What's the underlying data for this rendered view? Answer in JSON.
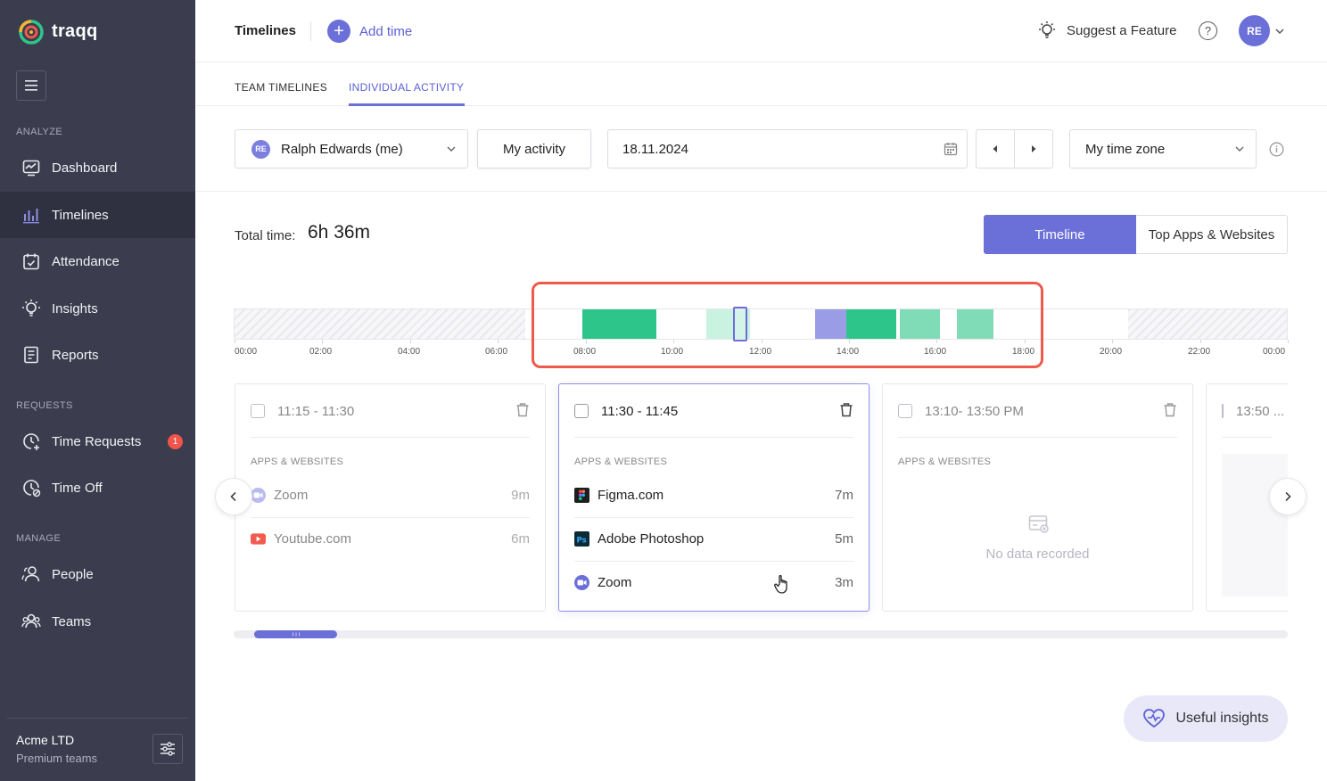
{
  "brand": {
    "name": "traqq"
  },
  "sidebar": {
    "sections": [
      {
        "label": "ANALYZE"
      },
      {
        "label": "REQUESTS"
      },
      {
        "label": "MANAGE"
      }
    ],
    "items": [
      {
        "label": "Dashboard",
        "icon": "dashboard-icon"
      },
      {
        "label": "Timelines",
        "icon": "timelines-icon",
        "active": true
      },
      {
        "label": "Attendance",
        "icon": "attendance-icon"
      },
      {
        "label": "Insights",
        "icon": "insights-icon"
      },
      {
        "label": "Reports",
        "icon": "reports-icon"
      },
      {
        "label": "Time Requests",
        "icon": "time-requests-icon",
        "badge": "1"
      },
      {
        "label": "Time Off",
        "icon": "time-off-icon"
      },
      {
        "label": "People",
        "icon": "people-icon"
      },
      {
        "label": "Teams",
        "icon": "teams-icon"
      }
    ],
    "org": {
      "name": "Acme LTD",
      "plan": "Premium teams"
    }
  },
  "header": {
    "title": "Timelines",
    "add_time": "Add time",
    "suggest": "Suggest a Feature",
    "help": "?",
    "avatar_initials": "RE"
  },
  "tabs": [
    {
      "label": "TEAM TIMELINES"
    },
    {
      "label": "INDIVIDUAL ACTIVITY",
      "active": true
    }
  ],
  "filters": {
    "user": {
      "initials": "RE",
      "name": "Ralph Edwards (me)"
    },
    "activity": "My activity",
    "date": "18.11.2024",
    "timezone": "My time zone"
  },
  "summary": {
    "total_label": "Total time:",
    "total_value": "6h 36m",
    "view_timeline": "Timeline",
    "view_top_apps": "Top Apps & Websites"
  },
  "timeline": {
    "ticks": [
      "00:00",
      "02:00",
      "04:00",
      "06:00",
      "08:00",
      "10:00",
      "12:00",
      "14:00",
      "16:00",
      "18:00",
      "20:00",
      "22:00",
      "00:00"
    ],
    "segments": [
      {
        "start": "07:56",
        "end": "09:37",
        "color": "#2ec58a"
      },
      {
        "start": "10:45",
        "end": "11:45",
        "color": "#c9f2e1"
      },
      {
        "start": "13:15",
        "end": "13:57",
        "color": "#9a9ce6"
      },
      {
        "start": "13:57",
        "end": "15:05",
        "color": "#2ec58a"
      },
      {
        "start": "15:10",
        "end": "16:05",
        "color": "#7fdcb7"
      },
      {
        "start": "16:28",
        "end": "17:18",
        "color": "#7fdcb7"
      }
    ],
    "colors": {
      "highlight": "#ee5a4b",
      "selection": "#6b6fd8"
    }
  },
  "cards": [
    {
      "time": "11:15 - 11:30",
      "apps_label": "APPS & WEBSITES",
      "apps": [
        {
          "name": "Zoom",
          "duration": "9m",
          "icon": "zoom-icon"
        },
        {
          "name": "Youtube.com",
          "duration": "6m",
          "icon": "youtube-icon"
        }
      ]
    },
    {
      "time": "11:30 - 11:45",
      "apps_label": "APPS & WEBSITES",
      "apps": [
        {
          "name": "Figma.com",
          "duration": "7m",
          "icon": "figma-icon"
        },
        {
          "name": "Adobe Photoshop",
          "duration": "5m",
          "icon": "photoshop-icon"
        },
        {
          "name": "Zoom",
          "duration": "3m",
          "icon": "zoom-icon"
        }
      ]
    },
    {
      "time": "13:10- 13:50 PM",
      "apps_label": "APPS & WEBSITES",
      "empty": "No data recorded"
    },
    {
      "time": "13:50 ..."
    }
  ],
  "insights_button": "Useful insights"
}
